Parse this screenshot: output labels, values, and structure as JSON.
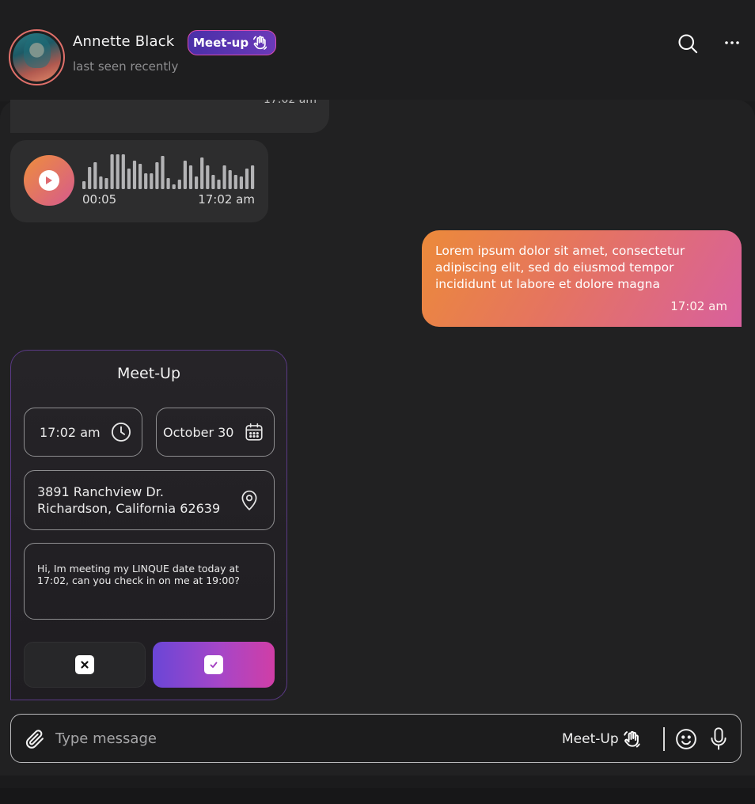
{
  "header": {
    "contact_name": "Annette Black",
    "badge_label": "Meet-up",
    "status": "last seen recently"
  },
  "messages": {
    "partial_time": "17:02 am",
    "voice": {
      "duration": "00:05",
      "time": "17:02 am"
    },
    "sent": {
      "text": "Lorem ipsum dolor sit amet, consectetur adipiscing elit, sed do eiusmod tempor incididunt ut labore et dolore magna",
      "time": "17:02 am"
    }
  },
  "meetup_card": {
    "title": "Meet-Up",
    "time": "17:02 am",
    "date": "October 30",
    "address_line1": "3891 Ranchview Dr.",
    "address_line2": "Richardson, California 62639",
    "note": "Hi, Im meeting my LINQUE date today at 17:02, can you check in on me at 19:00?"
  },
  "composer": {
    "placeholder": "Type message",
    "meetup_label": "Meet-Up"
  },
  "icons": {
    "search": "search-icon",
    "more": "more-icon",
    "play": "play-icon",
    "clock": "clock-icon",
    "calendar": "calendar-icon",
    "location": "location-pin-icon",
    "wave_hand": "waving-hand-icon",
    "attach": "paperclip-icon",
    "emoji": "emoji-icon",
    "mic": "microphone-icon"
  },
  "colors": {
    "accent_orange": "#ec8a3a",
    "accent_pink": "#d8609d",
    "accent_purple": "#6a46d6"
  }
}
